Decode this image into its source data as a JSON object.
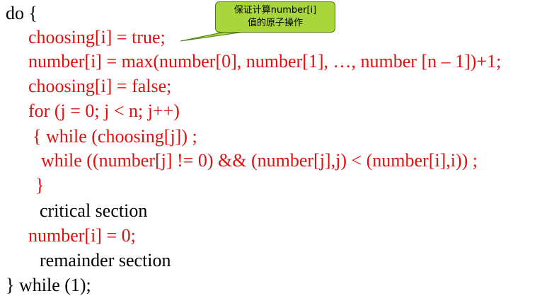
{
  "callout": {
    "line1": "保证计算number[i]",
    "line2": "值的原子操作",
    "fill_color": "#a8d63c"
  },
  "code": {
    "l1": "do {",
    "l2": "choosing[i] = true;",
    "l3": "number[i] = max(number[0], number[1], …, number [n – 1])+1;",
    "l4": "choosing[i] = false;",
    "l5": "for (j = 0; j < n; j++)",
    "l6": "{ while (choosing[j]) ;",
    "l7": "while ((number[j] != 0) && (number[j],j) < (number[i],i)) ;",
    "l8": "}",
    "l9": "critical section",
    "l10": "number[i] = 0;",
    "l11": "remainder section",
    "l12": "} while (1);"
  },
  "colors": {
    "code_red": "#e01010",
    "code_black": "#000000"
  }
}
